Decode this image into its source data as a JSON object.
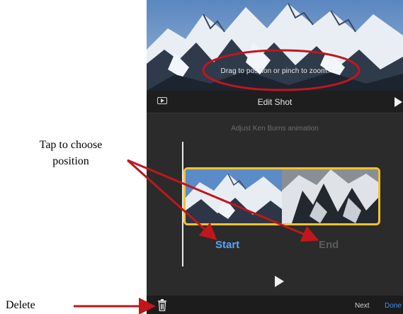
{
  "preview": {
    "hint": "Drag to position or pinch to zoom."
  },
  "toolbar": {
    "title": "Edit Shot",
    "preview_icon": "preview-screen-icon",
    "play_icon": "play-icon"
  },
  "editor": {
    "subtitle": "Adjust Ken Burns animation",
    "start_label": "Start",
    "end_label": "End",
    "play_icon": "play-icon"
  },
  "bottom_bar": {
    "delete_icon": "trash-icon",
    "next_label": "Next",
    "done_label": "Done"
  },
  "annotations": {
    "tap_line1": "Tap to choose",
    "tap_line2": "position",
    "delete": "Delete"
  },
  "colors": {
    "accent_blue": "#58a6ff",
    "frame_yellow": "#f0c230",
    "annotation_red": "#c0161c"
  }
}
